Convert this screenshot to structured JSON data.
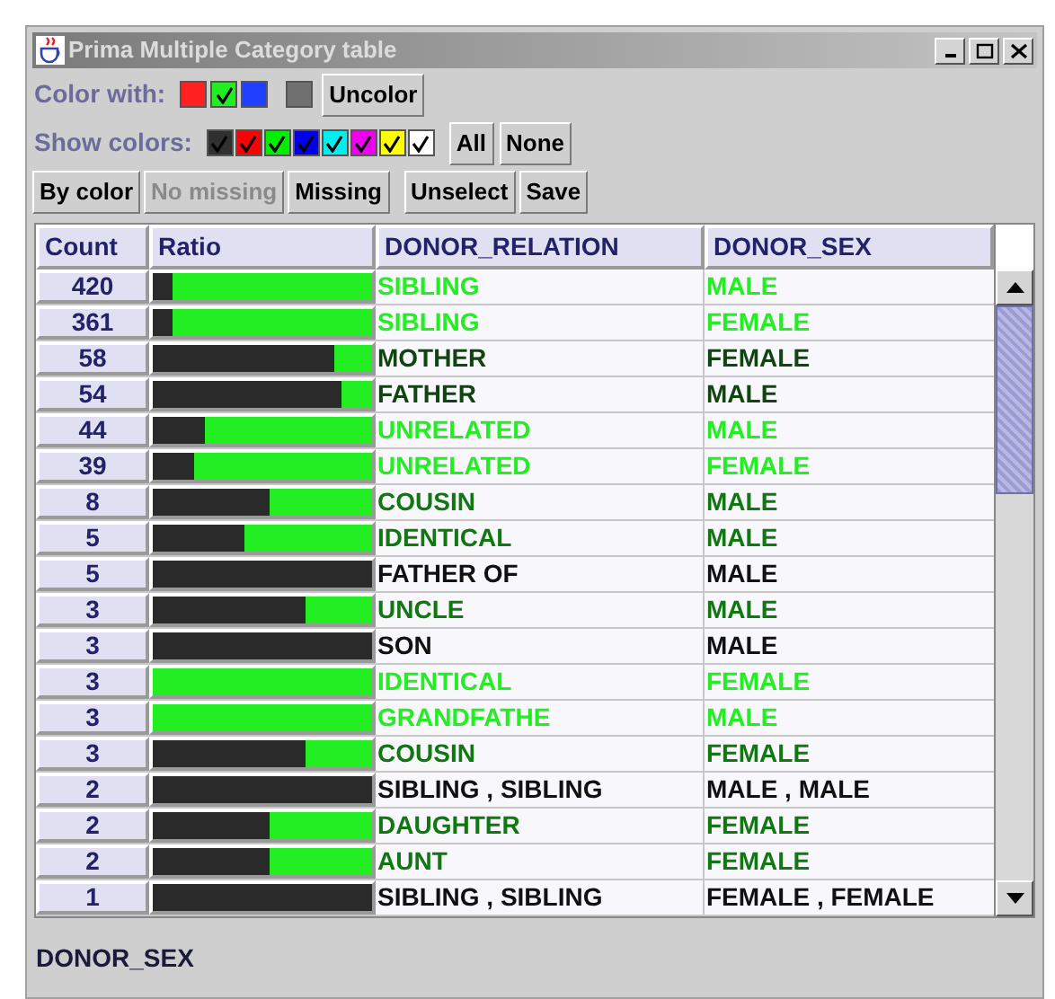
{
  "window": {
    "title": "Prima Multiple Category table"
  },
  "color_with": {
    "label": "Color with:",
    "swatches": [
      {
        "color": "#ff2020",
        "checked": false
      },
      {
        "color": "#20ee20",
        "checked": true
      },
      {
        "color": "#2040ff",
        "checked": false
      },
      {
        "color": "#707070",
        "checked": false
      }
    ],
    "button": "Uncolor"
  },
  "show_colors": {
    "label": "Show colors:",
    "swatches": [
      {
        "color": "#303030",
        "checked": true
      },
      {
        "color": "#ff0000",
        "checked": true
      },
      {
        "color": "#00ee00",
        "checked": true
      },
      {
        "color": "#0000ee",
        "checked": true
      },
      {
        "color": "#00eeee",
        "checked": true
      },
      {
        "color": "#ee00ee",
        "checked": true
      },
      {
        "color": "#ffff00",
        "checked": true
      },
      {
        "color": "#ffffff",
        "checked": true
      }
    ],
    "buttons": [
      "All",
      "None"
    ]
  },
  "toolbar": [
    {
      "label": "By color",
      "disabled": false
    },
    {
      "label": "No missing",
      "disabled": true
    },
    {
      "label": "Missing",
      "disabled": false
    },
    {
      "label": "Unselect",
      "disabled": false
    },
    {
      "label": "Save",
      "disabled": false
    }
  ],
  "table": {
    "columns": [
      "Count",
      "Ratio",
      "DONOR_RELATION",
      "DONOR_SEX"
    ],
    "rows": [
      {
        "count": "420",
        "level": 0.91,
        "relation": "SIBLING",
        "sex": "MALE",
        "color": "#22ee22"
      },
      {
        "count": "361",
        "level": 0.91,
        "relation": "SIBLING",
        "sex": "FEMALE",
        "color": "#22ee22"
      },
      {
        "count": "58",
        "level": 0.17,
        "relation": "MOTHER",
        "sex": "FEMALE",
        "color": "#114411"
      },
      {
        "count": "54",
        "level": 0.14,
        "relation": "FATHER",
        "sex": "MALE",
        "color": "#114411"
      },
      {
        "count": "44",
        "level": 0.76,
        "relation": "UNRELATED",
        "sex": "MALE",
        "color": "#22ee22"
      },
      {
        "count": "39",
        "level": 0.81,
        "relation": "UNRELATED",
        "sex": "FEMALE",
        "color": "#22ee22"
      },
      {
        "count": "8",
        "level": 0.47,
        "relation": "COUSIN",
        "sex": "MALE",
        "color": "#117711"
      },
      {
        "count": "5",
        "level": 0.58,
        "relation": "IDENTICAL",
        "sex": "MALE",
        "color": "#117711"
      },
      {
        "count": "5",
        "level": 0,
        "relation": "FATHER OF",
        "sex": "MALE",
        "color": "#111111"
      },
      {
        "count": "3",
        "level": 0.3,
        "relation": "UNCLE",
        "sex": "MALE",
        "color": "#117711"
      },
      {
        "count": "3",
        "level": 0,
        "relation": "SON",
        "sex": "MALE",
        "color": "#111111"
      },
      {
        "count": "3",
        "level": 1,
        "relation": "IDENTICAL",
        "sex": "FEMALE",
        "color": "#22ee22"
      },
      {
        "count": "3",
        "level": 1,
        "relation": "GRANDFATHE",
        "sex": "MALE",
        "color": "#22ee22"
      },
      {
        "count": "3",
        "level": 0.3,
        "relation": "COUSIN",
        "sex": "FEMALE",
        "color": "#117711"
      },
      {
        "count": "2",
        "level": 0,
        "relation": "SIBLING , SIBLING",
        "sex": "MALE , MALE",
        "color": "#111111"
      },
      {
        "count": "2",
        "level": 0.47,
        "relation": "DAUGHTER",
        "sex": "FEMALE",
        "color": "#117711"
      },
      {
        "count": "2",
        "level": 0.47,
        "relation": "AUNT",
        "sex": "FEMALE",
        "color": "#117711"
      },
      {
        "count": "1",
        "level": 0,
        "relation": "SIBLING , SIBLING",
        "sex": "FEMALE , FEMALE",
        "color": "#111111"
      }
    ]
  },
  "status_bar": "DONOR_SEX"
}
